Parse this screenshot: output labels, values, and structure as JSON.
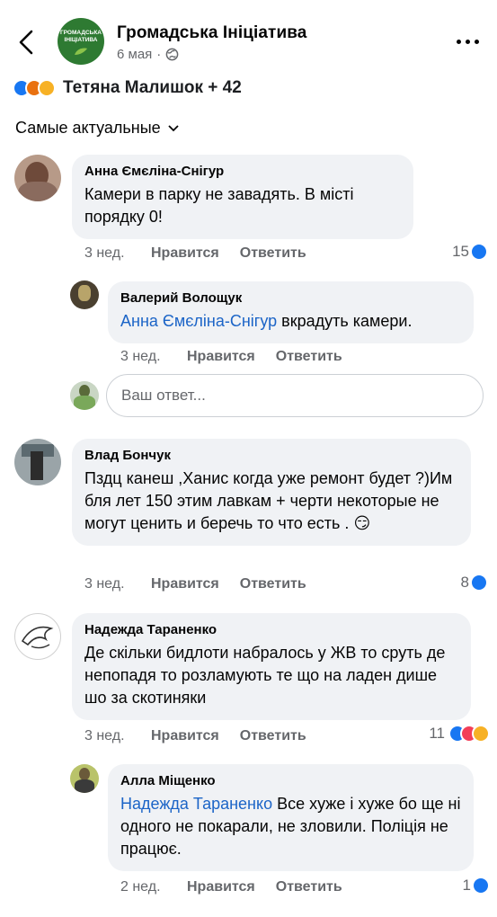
{
  "header": {
    "page_name": "Громадська Ініціатива",
    "logo_text": "ГРОМАДСЬКА ІНІЦІАТИВА",
    "date": "6 мая",
    "privacy_icon": "globe-icon",
    "more_icon": "more-dots-icon"
  },
  "reactions": {
    "icons": [
      "like-icon",
      "angry-icon",
      "sad-icon"
    ],
    "names": "Тетяна Малишок + 42"
  },
  "sort": {
    "label": "Самые актуальные",
    "icon": "chevron-down-icon"
  },
  "labels": {
    "like": "Нравится",
    "reply": "Ответить"
  },
  "reply_box": {
    "placeholder": "Ваш ответ..."
  },
  "comments": [
    {
      "author": "Анна Ємєліна-Снігур",
      "text": "Камери в парку не завадять.  В місті порядку 0!",
      "time": "3 нед.",
      "reactions": "15",
      "replies": [
        {
          "author": "Валерий Волощук",
          "mention": "Анна Ємєліна-Снігур",
          "text": " вкрадуть камери.",
          "time": "3 нед."
        }
      ]
    },
    {
      "author": "Влад Бончук",
      "text": "Пздц канеш ,Ханис когда уже ремонт будет ?)Им бля лет 150 этим лавкам + черти некоторые не могут ценить и беречь то что есть .",
      "emoji": "😏",
      "time": "3 нед.",
      "reactions": "8"
    },
    {
      "author": "Надежда Тараненко",
      "text": "Де скільки бидлоти набралось у ЖВ то сруть де непопадя то розламують те що на ладен дише шо за скотиняки",
      "time": "3 нед.",
      "reactions": "11",
      "replies": [
        {
          "author": "Алла Міщенко",
          "mention": "Надежда Тараненко",
          "text": " Все хуже і хуже бо ще ні одного не покарали, не зловили. Поліція не працює.",
          "time": "2 нед.",
          "reactions": "1"
        }
      ]
    }
  ],
  "colors": {
    "like": "#1877f2",
    "love": "#f33e58",
    "sad": "#f7b125",
    "mention": "#1b64c7",
    "bubble": "#f0f2f5"
  }
}
